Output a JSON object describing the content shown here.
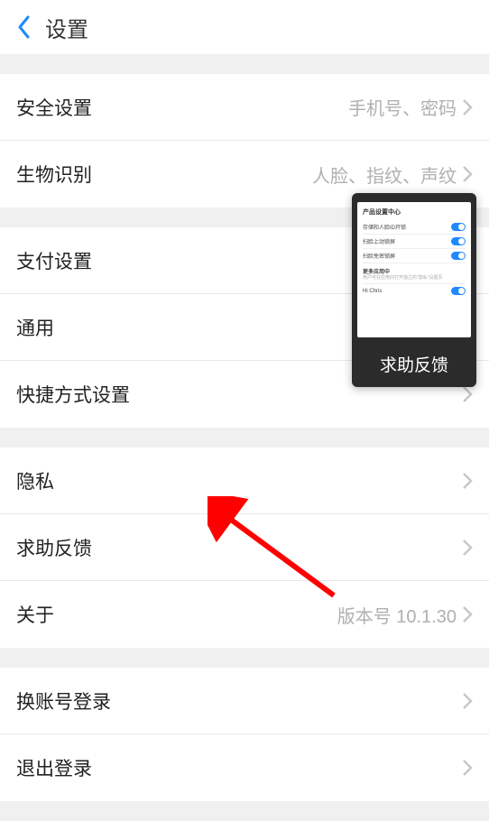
{
  "header": {
    "title": "设置"
  },
  "group1": {
    "security": {
      "label": "安全设置",
      "note": "手机号、密码"
    },
    "biometric": {
      "label": "生物识别",
      "note": "人脸、指纹、声纹"
    }
  },
  "group2": {
    "payment": {
      "label": "支付设置"
    },
    "general": {
      "label": "通用"
    },
    "shortcut": {
      "label": "快捷方式设置"
    }
  },
  "group3": {
    "privacy": {
      "label": "隐私"
    },
    "help": {
      "label": "求助反馈"
    },
    "about": {
      "label": "关于",
      "note": "版本号 10.1.30"
    }
  },
  "group4": {
    "switch": {
      "label": "换账号登录"
    },
    "logout": {
      "label": "退出登录"
    }
  },
  "float": {
    "label": "求助反馈"
  }
}
